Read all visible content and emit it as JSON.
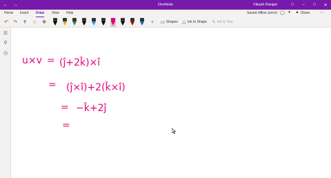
{
  "titlebar": {
    "back_icon": "back-arrow-icon",
    "forward_icon": "forward-arrow-icon",
    "app_title": "OneNote",
    "user_name": "Vikash Ranjan",
    "color": "#7719aa"
  },
  "menu": {
    "tabs": [
      "Home",
      "Insert",
      "Draw",
      "View",
      "Help"
    ],
    "active_tab": "Draw",
    "saved_status": "Saved offline (error)",
    "share_label": "Share"
  },
  "ribbon": {
    "shapes_label": "Shapes",
    "ink_to_shape_label": "Ink to Shape",
    "ink_to_text_label": "Ink to Text",
    "pen_colors": [
      "#000000",
      "#e8a317",
      "#2e8b57",
      "#000000",
      "#1e90ff",
      "#000000",
      "#e6007e",
      "#000000",
      "#c00000",
      "#1565c0"
    ]
  },
  "ink": {
    "color": "#e6007e",
    "line1_lhs": "u×v",
    "line1_eq": "=",
    "line1_rhs": "(ĵ+2k̂)×î",
    "line2_eq": "=",
    "line2_rhs": "(ĵ×î)+2(k̂×î)",
    "line3_eq": "=",
    "line3_rhs": "−k̂+2ĵ",
    "line4_eq": "="
  }
}
